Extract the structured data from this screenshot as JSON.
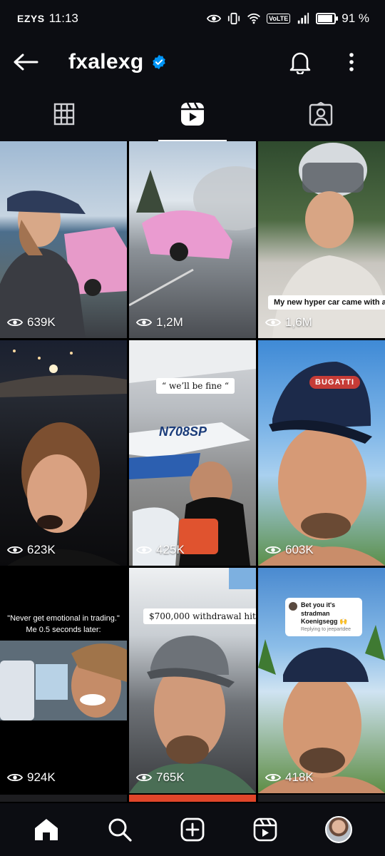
{
  "status_bar": {
    "carrier": "EZYS",
    "time": "11:13",
    "network": "VoLTE",
    "battery": "91 %",
    "battery_level": 0.91
  },
  "header": {
    "username": "fxalexg"
  },
  "tabs": [
    {
      "name": "posts-grid",
      "active": false
    },
    {
      "name": "reels",
      "active": true
    },
    {
      "name": "tagged",
      "active": false
    }
  ],
  "reels": [
    {
      "views": "639K"
    },
    {
      "views": "1,2M"
    },
    {
      "views": "1,6M",
      "caption": "My new hyper car came with a helmet"
    },
    {
      "views": "623K"
    },
    {
      "views": "425K",
      "caption": "“ we’ll be fine “",
      "plane_text": "N708SP"
    },
    {
      "views": "603K",
      "hat_text": "BUGATTI"
    },
    {
      "views": "924K",
      "caption_line1": "\"Never get emotional in trading.\"",
      "caption_line2": "Me 0.5 seconds later:"
    },
    {
      "views": "765K",
      "caption": "$700,000 withdrawal hit"
    },
    {
      "views": "418K",
      "comment": "Bet you it's stradman Koenigsegg 🙌",
      "reply": "Replying to jeepartdee"
    }
  ],
  "colors": {
    "bar_bg": "#0c0d12",
    "accent": "#0095f6"
  }
}
